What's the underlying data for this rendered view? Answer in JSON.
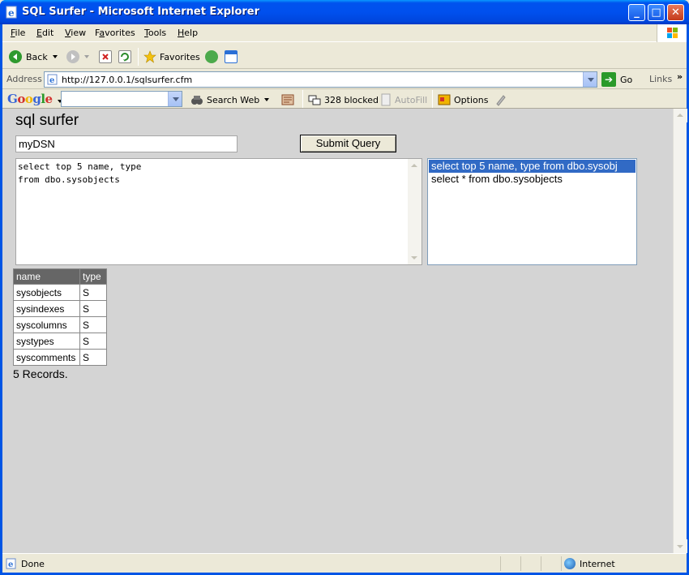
{
  "window": {
    "title": "SQL Surfer - Microsoft Internet Explorer",
    "buttons": {
      "minimize": "_",
      "maximize": "□",
      "close": "✕"
    }
  },
  "menu": {
    "items": [
      {
        "prefix": "",
        "accel": "F",
        "rest": "ile"
      },
      {
        "prefix": "",
        "accel": "E",
        "rest": "dit"
      },
      {
        "prefix": "",
        "accel": "V",
        "rest": "iew"
      },
      {
        "prefix": "F",
        "accel": "a",
        "rest": "vorites"
      },
      {
        "prefix": "",
        "accel": "T",
        "rest": "ools"
      },
      {
        "prefix": "",
        "accel": "H",
        "rest": "elp"
      }
    ]
  },
  "toolbar": {
    "back_label": "Back",
    "favorites_label": "Favorites"
  },
  "address": {
    "label": "Address",
    "url": "http://127.0.0.1/sqlsurfer.cfm",
    "go_label": "Go",
    "links_label": "Links"
  },
  "google_bar": {
    "logo": "Google",
    "search_value": "",
    "search_web_label": "Search Web",
    "blocked_label": "328 blocked",
    "autofill_label": "AutoFill",
    "options_label": "Options"
  },
  "page": {
    "heading": "sql surfer",
    "dsn_value": "myDSN",
    "submit_label": "Submit Query",
    "query_text": "select top 5 name, type\nfrom dbo.sysobjects",
    "history": [
      {
        "text": "select top 5 name, type from dbo.sysobj",
        "selected": true
      },
      {
        "text": "select * from dbo.sysobjects",
        "selected": false
      }
    ],
    "results": {
      "columns": [
        "name",
        "type"
      ],
      "rows": [
        [
          "sysobjects",
          "S"
        ],
        [
          "sysindexes",
          "S"
        ],
        [
          "syscolumns",
          "S"
        ],
        [
          "systypes",
          "S"
        ],
        [
          "syscomments",
          "S"
        ]
      ]
    },
    "record_count": "5 Records."
  },
  "status": {
    "text": "Done",
    "zone": "Internet"
  },
  "colors": {
    "title_bar": "#0053ee",
    "page_background": "#d4d4d4",
    "selection": "#316ac5",
    "results_header": "#666666"
  }
}
